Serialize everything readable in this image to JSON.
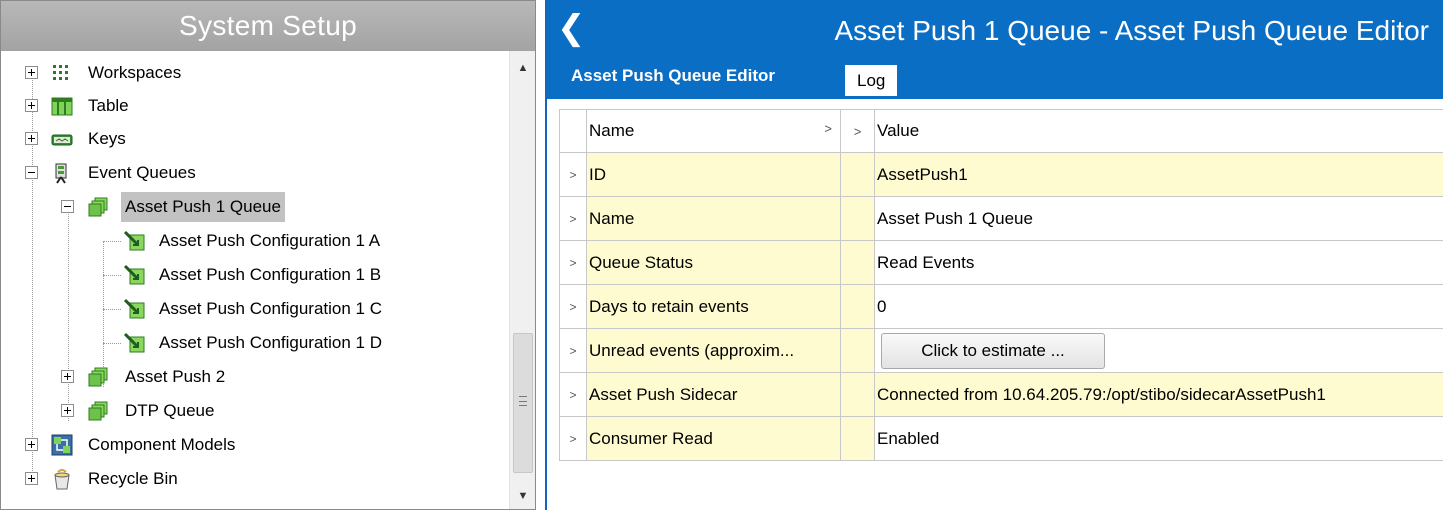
{
  "left": {
    "title": "System Setup",
    "tree": [
      {
        "label": "Workspaces",
        "expander": "plus",
        "selected": false
      },
      {
        "label": "Table",
        "expander": "plus",
        "selected": false
      },
      {
        "label": "Keys",
        "expander": "plus",
        "selected": false
      },
      {
        "label": "Event Queues",
        "expander": "minus",
        "selected": false
      },
      {
        "label": "Asset Push 1 Queue",
        "expander": "minus",
        "selected": true
      },
      {
        "label": "Asset Push Configuration 1 A",
        "expander": "none",
        "selected": false
      },
      {
        "label": "Asset Push Configuration 1 B",
        "expander": "none",
        "selected": false
      },
      {
        "label": "Asset Push Configuration 1 C",
        "expander": "none",
        "selected": false
      },
      {
        "label": "Asset Push Configuration 1 D",
        "expander": "none",
        "selected": false
      },
      {
        "label": "Asset Push 2",
        "expander": "plus",
        "selected": false
      },
      {
        "label": "DTP Queue",
        "expander": "plus",
        "selected": false
      },
      {
        "label": "Component Models",
        "expander": "plus",
        "selected": false
      },
      {
        "label": "Recycle Bin",
        "expander": "plus",
        "selected": false
      }
    ],
    "icons": {
      "workspaces": "workspaces-icon",
      "table": "table-icon",
      "keys": "keys-icon",
      "event_queues": "event-queues-icon",
      "queue": "queue-icon",
      "configuration": "configuration-icon",
      "component_models": "component-models-icon",
      "recycle_bin": "recycle-bin-icon"
    }
  },
  "right": {
    "title": "Asset Push 1 Queue - Asset Push Queue Editor",
    "back_icon": "chevron-left-icon",
    "tabs": [
      {
        "label": "Asset Push Queue Editor",
        "active": true
      },
      {
        "label": "Log",
        "active": false
      }
    ],
    "grid": {
      "headers": {
        "name": "Name",
        "value": "Value"
      },
      "rows": [
        {
          "name": "ID",
          "value": "AssetPush1",
          "type": "text"
        },
        {
          "name": "Name",
          "value": "Asset Push 1 Queue",
          "type": "text"
        },
        {
          "name": "Queue Status",
          "value": "Read Events",
          "type": "text"
        },
        {
          "name": "Days to retain events",
          "value": "0",
          "type": "text"
        },
        {
          "name": "Unread events (approxim...",
          "value": "Click to estimate ...",
          "type": "button"
        },
        {
          "name": "Asset Push Sidecar",
          "value": "Connected from 10.64.205.79:/opt/stibo/sidecarAssetPush1",
          "type": "text"
        },
        {
          "name": "Consumer Read",
          "value": "Enabled",
          "type": "text"
        }
      ]
    }
  },
  "colors": {
    "accent_blue": "#0b6ec5",
    "row_highlight": "#fffbd0",
    "left_header_gray": "#a8a8a8",
    "selected_gray": "#c2c2c2"
  }
}
